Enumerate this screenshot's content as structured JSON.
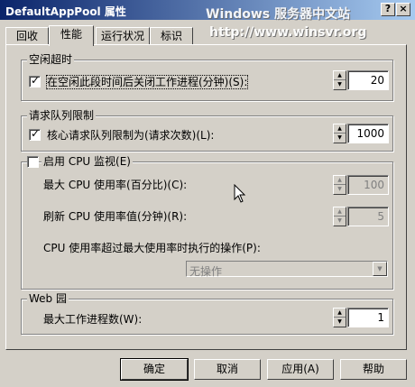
{
  "window": {
    "title": "DefaultAppPool 属性",
    "help_glyph": "?",
    "close_glyph": "×",
    "watermark_line1": "Windows 服务器中文站",
    "watermark_line2": "http://www.winsvr.org"
  },
  "tabs": [
    {
      "label": "回收",
      "active": false
    },
    {
      "label": "性能",
      "active": true
    },
    {
      "label": "运行状况",
      "active": false
    },
    {
      "label": "标识",
      "active": false
    }
  ],
  "idle": {
    "legend": "空闲超时",
    "check_label": "在空闲此段时间后关闭工作进程(分钟)(S):",
    "checked": true,
    "value": "20"
  },
  "queue": {
    "legend": "请求队列限制",
    "check_label": "核心请求队列限制为(请求次数)(L):",
    "checked": true,
    "value": "1000"
  },
  "cpu": {
    "legend": "启用 CPU 监视(E)",
    "checked": false,
    "max_label": "最大 CPU 使用率(百分比)(C):",
    "max_value": "100",
    "refresh_label": "刷新 CPU 使用率值(分钟)(R):",
    "refresh_value": "5",
    "action_label": "CPU 使用率超过最大使用率时执行的操作(P):",
    "action_value": "无操作"
  },
  "web_garden": {
    "legend": "Web 园",
    "max_label": "最大工作进程数(W):",
    "max_value": "1"
  },
  "buttons": {
    "ok": "确定",
    "cancel": "取消",
    "apply": "应用(A)",
    "help": "帮助"
  },
  "glyphs": {
    "check": "✓",
    "spin_up": "▲",
    "spin_down": "▼",
    "dropdown": "▼"
  }
}
